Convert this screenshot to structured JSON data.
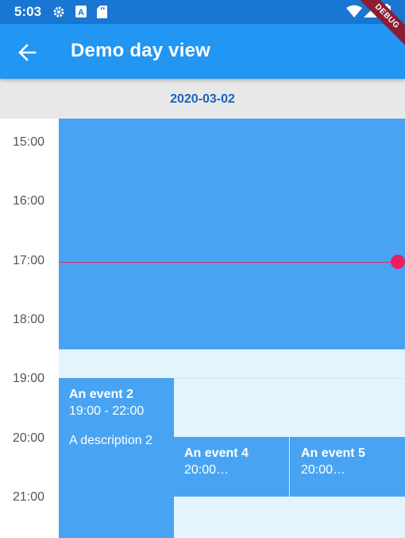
{
  "status_bar": {
    "time": "5:03",
    "icons": [
      "gear-icon",
      "a-badge-icon",
      "sd-card-icon",
      "wifi-icon",
      "signal-icon",
      "battery-icon"
    ]
  },
  "app_bar": {
    "title": "Demo day view",
    "back_icon": "arrow-left-icon"
  },
  "debug_banner": "DEBUG",
  "date_header": "2020-03-02",
  "hours": [
    "15:00",
    "16:00",
    "17:00",
    "18:00",
    "19:00",
    "20:00",
    "21:00"
  ],
  "events": {
    "e1": {
      "title": "",
      "time": ""
    },
    "e2": {
      "title": "An event 2",
      "time": "19:00 - 22:00",
      "description": "A description 2"
    },
    "e4": {
      "title": "An event 4",
      "time": "20:00…"
    },
    "e5": {
      "title": "An event 5",
      "time": "20:00…"
    }
  },
  "colors": {
    "status_bar": "#1976d2",
    "app_bar": "#2196f3",
    "event": "#48a4f2",
    "day_background": "#e3f4fd",
    "date_text": "#1565c0",
    "current_time": "#e91e63"
  }
}
